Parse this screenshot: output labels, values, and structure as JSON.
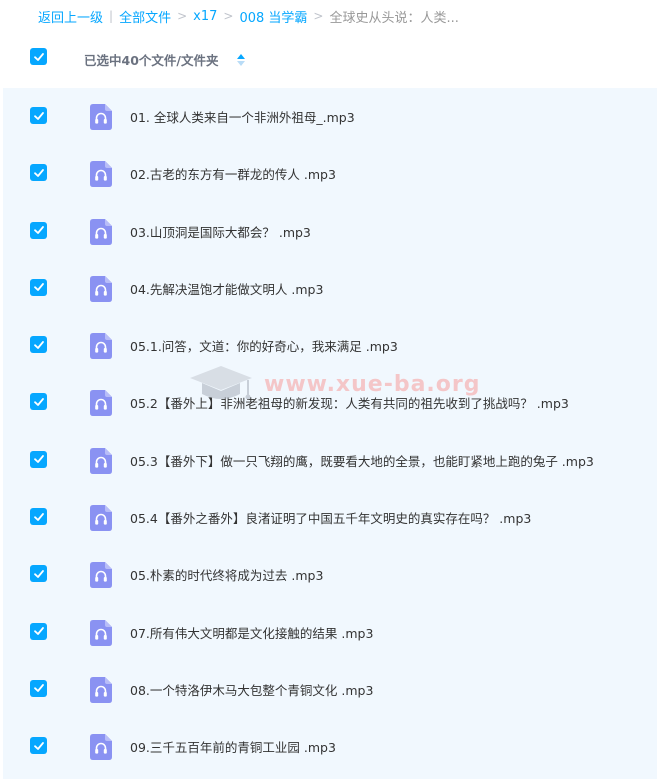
{
  "breadcrumb": {
    "items": [
      "返回上一级",
      "全部文件",
      "x17",
      "008 当学霸"
    ],
    "current": "全球史从头说：人类...",
    "separator": "|"
  },
  "header": {
    "selected_text": "已选中40个文件/文件夹"
  },
  "watermark": {
    "text": "www.xue-ba.org"
  },
  "files": [
    "01. 全球人类来自一个非洲外祖母_.mp3",
    "02.古老的东方有一群龙的传人 .mp3",
    "03.山顶洞是国际大都会？ .mp3",
    "04.先解决温饱才能做文明人 .mp3",
    "05.1.问答，文道：你的好奇心，我来满足 .mp3",
    "05.2【番外上】非洲老祖母的新发现：人类有共同的祖先收到了挑战吗？ .mp3",
    "05.3【番外下】做一只飞翔的鹰，既要看大地的全景，也能盯紧地上跑的兔子 .mp3",
    "05.4【番外之番外】良渚证明了中国五千年文明史的真实存在吗？ .mp3",
    "05.朴素的时代终将成为过去 .mp3",
    "07.所有伟大文明都是文化接触的结果 .mp3",
    "08.一个特洛伊木马大包整个青铜文化 .mp3",
    "09.三千五百年前的青铜工业园 .mp3"
  ],
  "colors": {
    "accent": "#06a7ff",
    "file_icon": "#8a92f2",
    "list_background": "#f1f8fe"
  }
}
